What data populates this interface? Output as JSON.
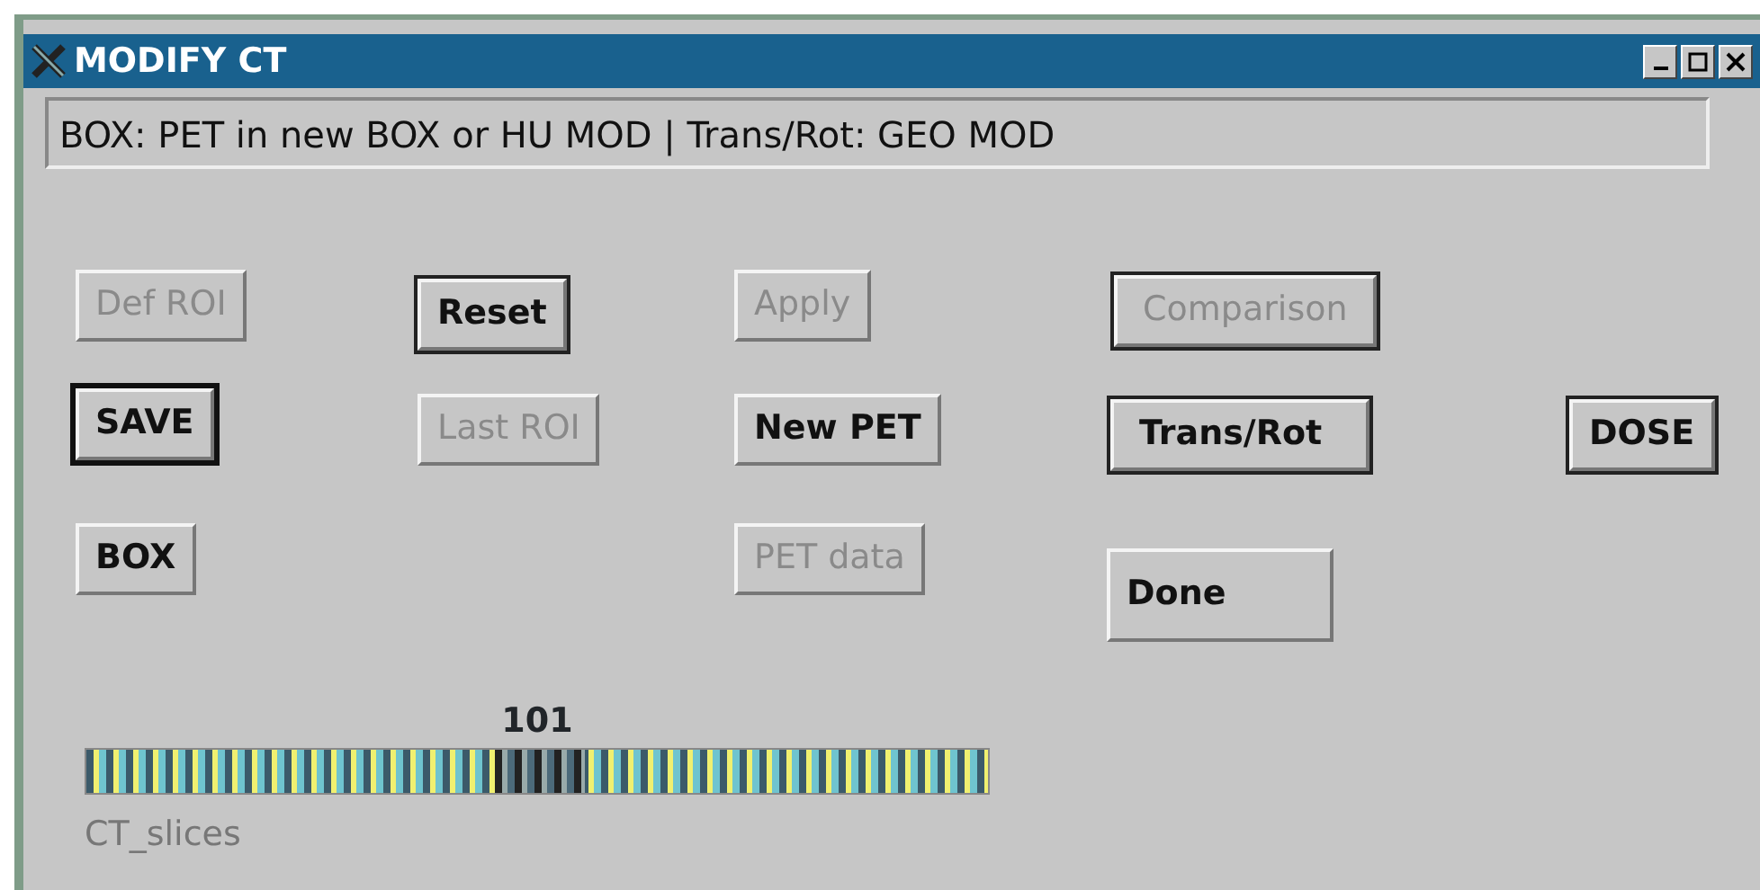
{
  "window": {
    "title": "MODIFY CT"
  },
  "message": "BOX: PET in new BOX or HU MOD | Trans/Rot: GEO MOD",
  "buttons": [
    {
      "label": "Def ROI",
      "kind": "plain",
      "disabled": true
    },
    {
      "label": "Reset",
      "kind": "outlined",
      "disabled": false
    },
    {
      "label": "Apply",
      "kind": "plain",
      "disabled": true
    },
    {
      "label": "Comparison",
      "kind": "outlined",
      "disabled": true
    },
    {
      "label": "SAVE",
      "kind": "default",
      "disabled": false
    },
    {
      "label": "Last ROI",
      "kind": "plain",
      "disabled": true
    },
    {
      "label": "New PET",
      "kind": "plain",
      "disabled": false
    },
    {
      "label": "Trans/Rot",
      "kind": "outlined",
      "disabled": false
    },
    {
      "label": "DOSE",
      "kind": "outlined",
      "disabled": false
    },
    {
      "label": "BOX",
      "kind": "plain",
      "disabled": false
    },
    {
      "label": "PET data",
      "kind": "plain",
      "disabled": true
    },
    {
      "label": "Done",
      "kind": "plain",
      "disabled": false
    }
  ],
  "slider": {
    "value": "101",
    "level": 0.5,
    "label": "CT_slices"
  }
}
